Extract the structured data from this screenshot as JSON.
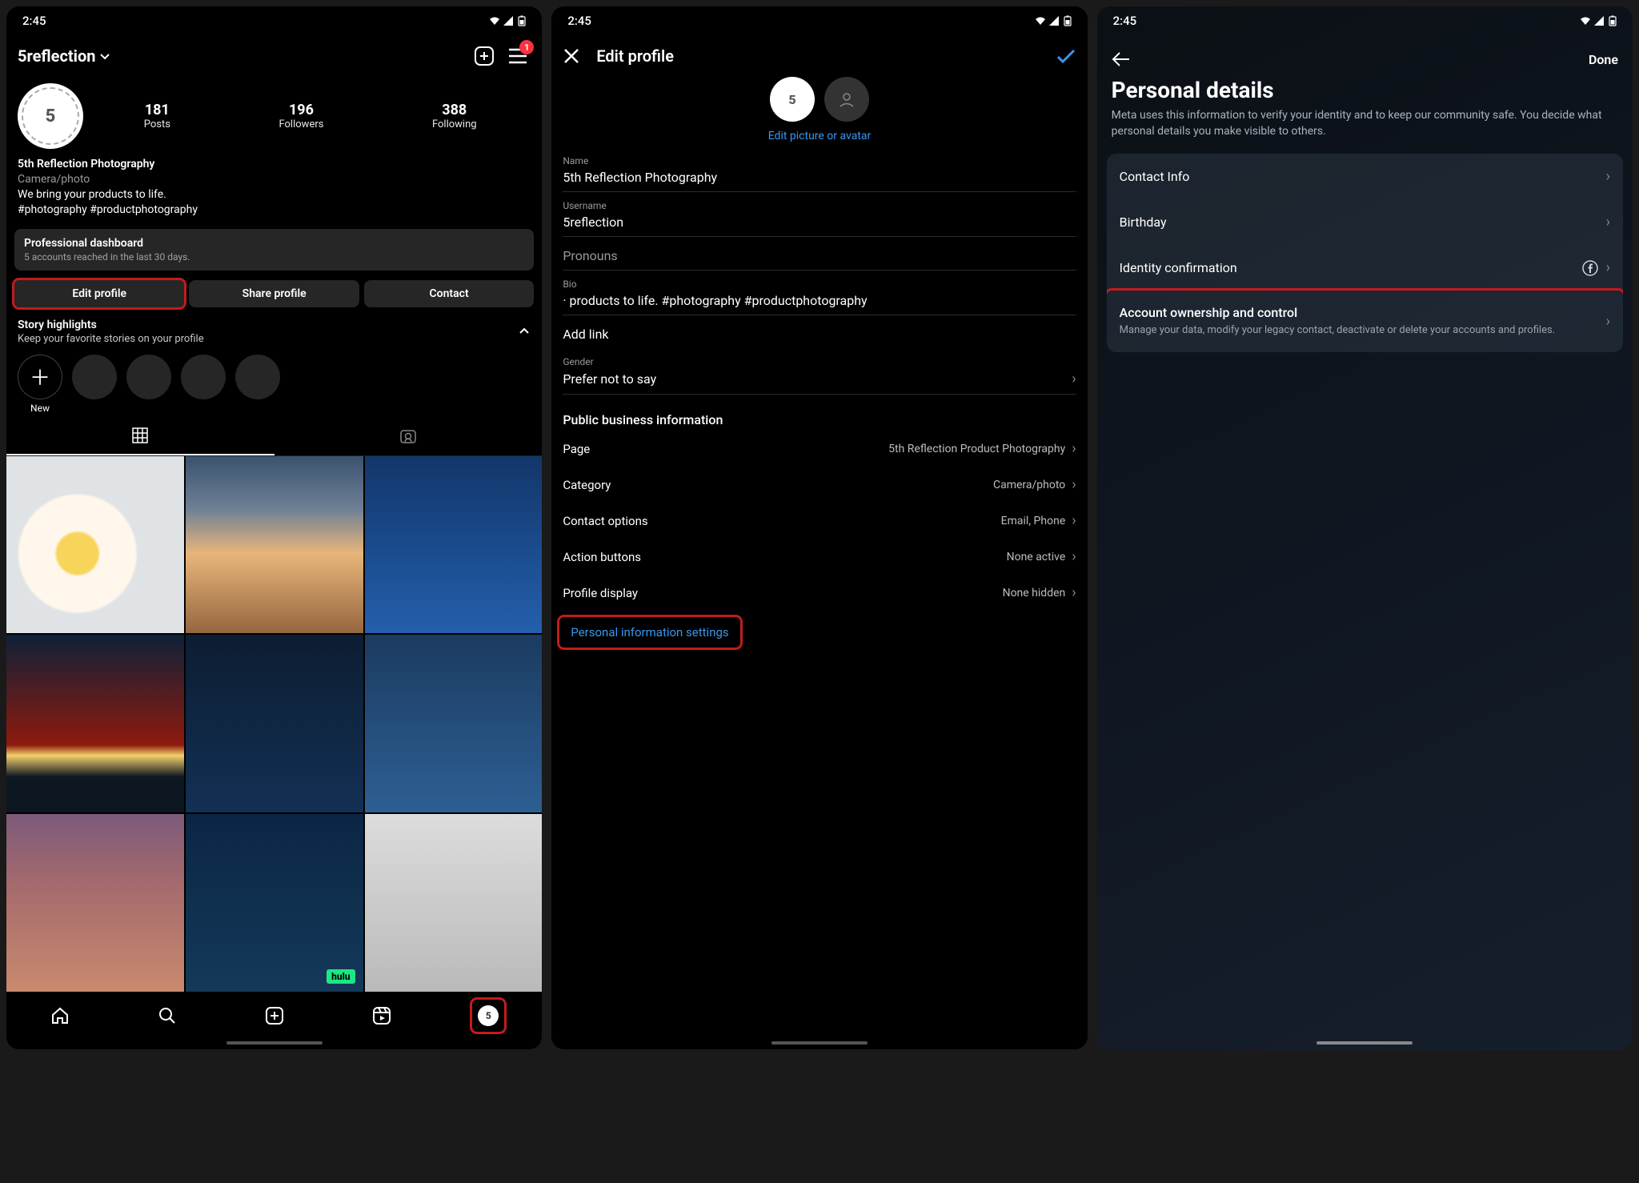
{
  "status": {
    "time": "2:45"
  },
  "screen1": {
    "username": "5reflection",
    "menu_badge": "1",
    "stats": {
      "posts": {
        "num": "181",
        "label": "Posts"
      },
      "followers": {
        "num": "196",
        "label": "Followers"
      },
      "following": {
        "num": "388",
        "label": "Following"
      }
    },
    "name": "5th Reflection Photography",
    "category": "Camera/photo",
    "bio1": "We bring your products to life.",
    "bio2": "#photography #productphotography",
    "dashboard_title": "Professional dashboard",
    "dashboard_sub": "5 accounts reached in the last 30 days.",
    "btn_edit": "Edit profile",
    "btn_share": "Share profile",
    "btn_contact": "Contact",
    "hl_title": "Story highlights",
    "hl_sub": "Keep your favorite stories on your profile",
    "hl_new": "New"
  },
  "screen2": {
    "title": "Edit profile",
    "edit_link": "Edit picture or avatar",
    "fields": {
      "name": {
        "label": "Name",
        "value": "5th Reflection Photography"
      },
      "username": {
        "label": "Username",
        "value": "5reflection"
      },
      "pronouns": {
        "label": "Pronouns",
        "value": ""
      },
      "bio": {
        "label": "Bio",
        "value": "· products to life. #photography #productphotography"
      },
      "addlink": "Add link",
      "gender": {
        "label": "Gender",
        "value": "Prefer not to say"
      }
    },
    "section": "Public business information",
    "rows": {
      "page": {
        "label": "Page",
        "value": "5th Reflection Product Photography"
      },
      "category": {
        "label": "Category",
        "value": "Camera/photo"
      },
      "contact": {
        "label": "Contact options",
        "value": "Email, Phone"
      },
      "action": {
        "label": "Action buttons",
        "value": "None active"
      },
      "display": {
        "label": "Profile display",
        "value": "None hidden"
      }
    },
    "personal": "Personal information settings"
  },
  "screen3": {
    "done": "Done",
    "title": "Personal details",
    "desc": "Meta uses this information to verify your identity and to keep our community safe. You decide what personal details you make visible to others.",
    "rows": {
      "contact": "Contact Info",
      "birthday": "Birthday",
      "identity": "Identity confirmation",
      "ownership_title": "Account ownership and control",
      "ownership_sub": "Manage your data, modify your legacy contact, deactivate or delete your accounts and profiles."
    }
  }
}
